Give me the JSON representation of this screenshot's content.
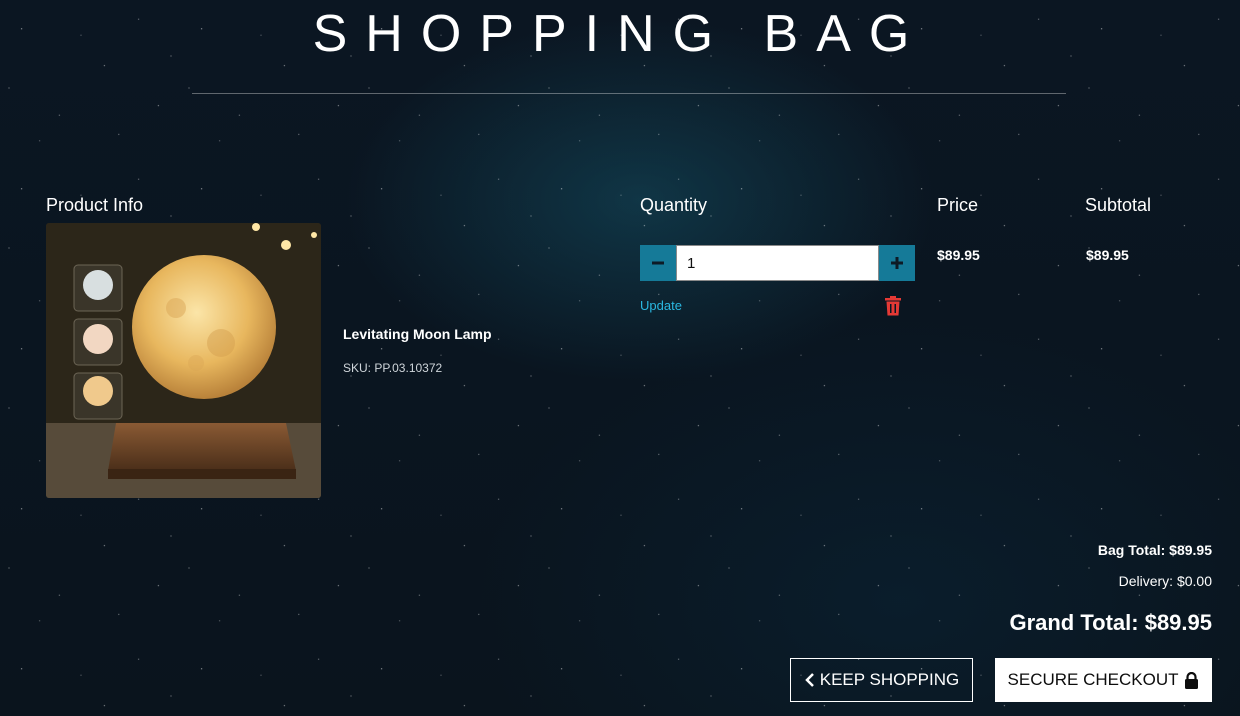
{
  "page_title": "SHOPPING BAG",
  "table_headers": {
    "product_info": "Product Info",
    "quantity": "Quantity",
    "price": "Price",
    "subtotal": "Subtotal"
  },
  "item": {
    "name": "Levitating Moon Lamp",
    "sku": "SKU: PP.03.10372",
    "quantity": "1",
    "update_label": "Update",
    "price": "$89.95",
    "subtotal": "$89.95",
    "image_icon": "moon-lamp-product-image"
  },
  "totals": {
    "bag_total": "Bag Total: $89.95",
    "delivery": "Delivery: $0.00",
    "grand_total": "Grand Total: $89.95"
  },
  "buttons": {
    "keep_shopping": "KEEP SHOPPING",
    "secure_checkout": "SECURE CHECKOUT"
  },
  "colors": {
    "accent": "#157a98",
    "link": "#2ab7e0",
    "danger": "#e53935",
    "background": "#0b1622"
  }
}
